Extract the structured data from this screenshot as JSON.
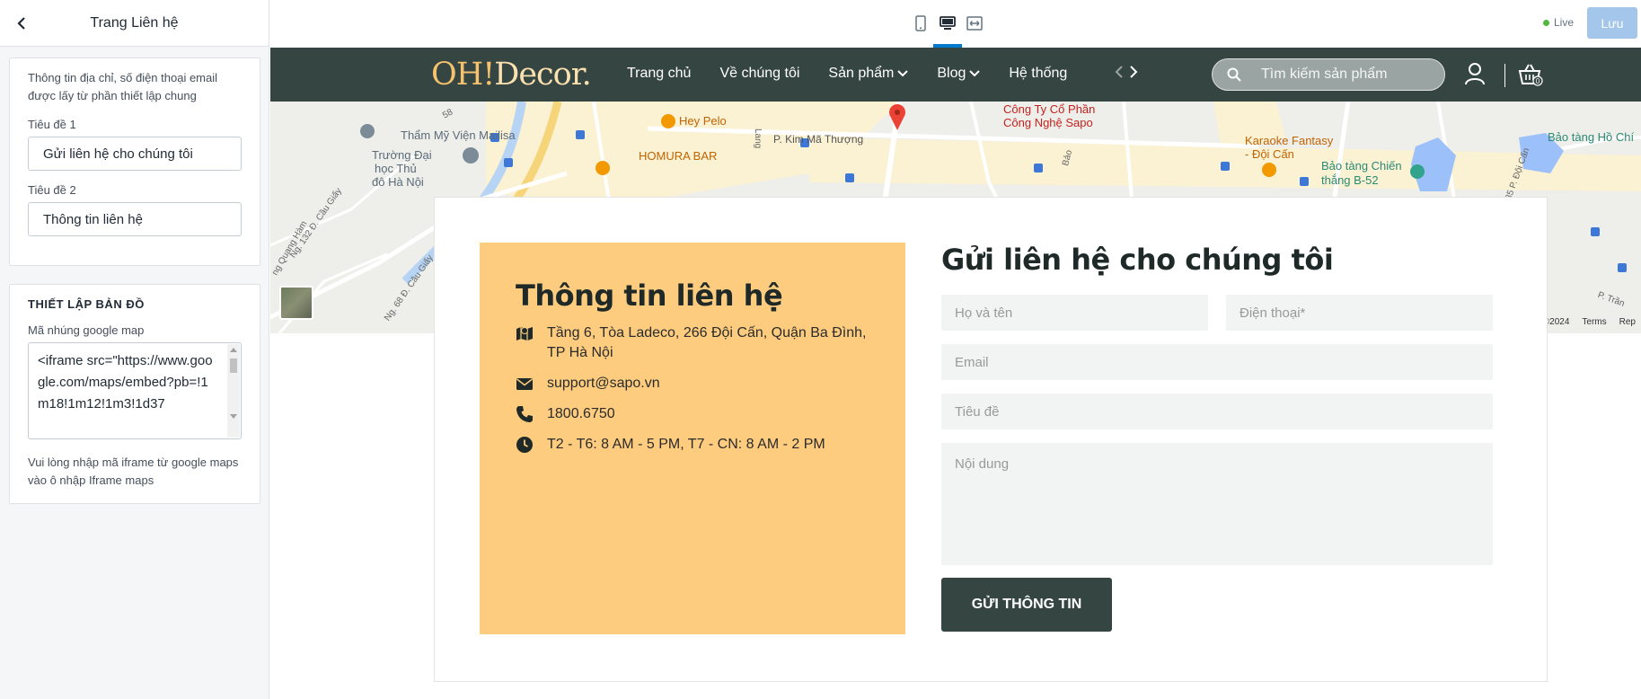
{
  "panel": {
    "title": "Trang Liên hệ",
    "note": "Thông tin địa chỉ, số điện thoại email được lấy từ phần thiết lập chung",
    "title1_label": "Tiêu đề 1",
    "title1_value": "Gửi liên hệ cho chúng tôi",
    "title2_label": "Tiêu đề 2",
    "title2_value": "Thông tin liên hệ",
    "map_section_title": "THIẾT LẬP BẢN ĐỒ",
    "map_embed_label": "Mã nhúng google map",
    "map_embed_value": "<iframe src=\"https://www.google.com/maps/embed?pb=!1m18!1m12!1m3!1d37",
    "map_help": "Vui lòng nhập mã iframe từ google maps vào ô nhập Iframe maps"
  },
  "toolbar": {
    "live_label": "Live",
    "save_label": "Lưu"
  },
  "site": {
    "logo_prefix": "OH!",
    "logo_suffix": "Decor.",
    "menu": [
      "Trang chủ",
      "Về chúng tôi",
      "Sản phẩm",
      "Blog",
      "Hệ thống"
    ],
    "search_placeholder": "Tìm kiếm sản phẩm",
    "cart_count": "0"
  },
  "map": {
    "labels": [
      "Công Ty Cổ Phần",
      "Công Nghệ Sapo",
      "Hey Pelo",
      "HOMURA BAR",
      "Thẩm Mỹ Viện Mailisa",
      "Trường Đại",
      "học Thủ",
      "đô Hà Nội",
      "P. Kim Mã Thượng",
      "Karaoke Fantasy",
      "- Đội Cấn",
      "Bảo tàng Chiến",
      "thắng B-52",
      "Bảo tàng Hồ Chí",
      "Ng. 132 Đ. Cầu Giấy",
      "Ng. 68 Đ. Cầu Giấy",
      "ng Quang Hàm",
      "Ng. 135 P. Đội Cấn",
      "Lang",
      "Bảo",
      "58",
      "P. Trần"
    ],
    "footer_copyright": "ta ©2024",
    "footer_terms": "Terms",
    "footer_report": "Rep"
  },
  "contact": {
    "info_title": "Thông tin liên hệ",
    "address": "Tầng 6, Tòa Ladeco, 266 Đội Cấn, Quận Ba Đình, TP Hà Nội",
    "email": "support@sapo.vn",
    "phone": "1800.6750",
    "hours": "T2 - T6: 8 AM - 5 PM, T7 - CN: 8 AM - 2 PM",
    "form_title": "Gửi liên hệ cho chúng tôi",
    "name_placeholder": "Họ và tên",
    "phone_placeholder": "Điện thoại*",
    "email_placeholder": "Email",
    "subject_placeholder": "Tiêu đề",
    "message_placeholder": "Nội dung",
    "submit_label": "GỬI THÔNG TIN"
  },
  "colors": {
    "nav_bg": "#354542",
    "info_bg": "#fdcc7f",
    "accent": "#007ace",
    "live_dot": "#50b83c",
    "save_btn": "#a4c6ea"
  }
}
